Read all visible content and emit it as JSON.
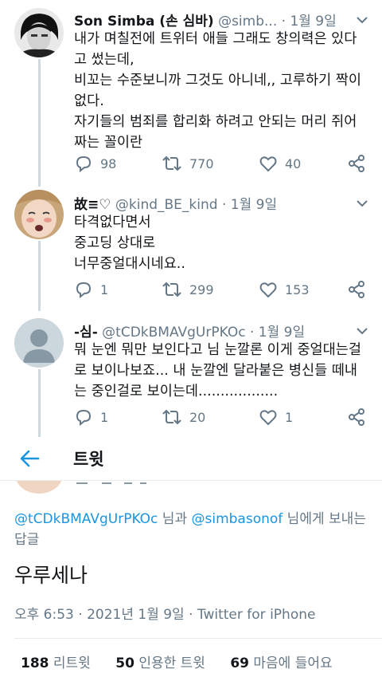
{
  "tweets": [
    {
      "name": "Son Simba (손 심바)",
      "handle": "@simb...",
      "date": "· 1월 9일",
      "text": "내가 며칠전에 트위터 애들 그래도 창의력은 있다\n고 썼는데,\n비꼬는 수준보니까 그것도 아니네,, 고루하기 짝이\n없다.\n자기들의 범죄를 합리화 하려고 안되는 머리 쥐어\n짜는 꼴이란",
      "replies": "98",
      "retweets": "770",
      "likes": "40"
    },
    {
      "name": "故≡♡",
      "handle": "@kind_BE_kind",
      "date": "· 1월 9일",
      "text": "타격없다면서\n중고딩 상대로\n너무중얼대시네요..",
      "replies": "1",
      "retweets": "299",
      "likes": "153"
    },
    {
      "name": "-심-",
      "handle": "@tCDkBMAVgUrPKOc",
      "date": "· 1월 9일",
      "text": "뭐 눈엔 뭐만 보인다고 님 눈깔론 이게 중얼대는걸\n로 보이나보죠... 내 눈깔엔 달라붙은 병신들 떼내\n는 중인걸로 보이는데..................",
      "replies": "1",
      "retweets": "20",
      "likes": "1"
    }
  ],
  "header": {
    "title": "트윗"
  },
  "detail": {
    "mention1": "@tCDkBMAVgUrPKOc",
    "and": " 님과 ",
    "mention2": "@simbasonof",
    "suffix": " 님에게 보내는 답글",
    "text": "우루세나",
    "datetime": "오후 6:53 · 2021년 1월 9일 · Twitter for iPhone",
    "retweets_count": "188",
    "retweets_label": "리트윗",
    "quotes_count": "50",
    "quotes_label": "인용한 트윗",
    "likes_count": "69",
    "likes_label": "마음에 들어요"
  },
  "colors": {
    "accent": "#1b95e0",
    "muted": "#657786",
    "text": "#14171a"
  }
}
